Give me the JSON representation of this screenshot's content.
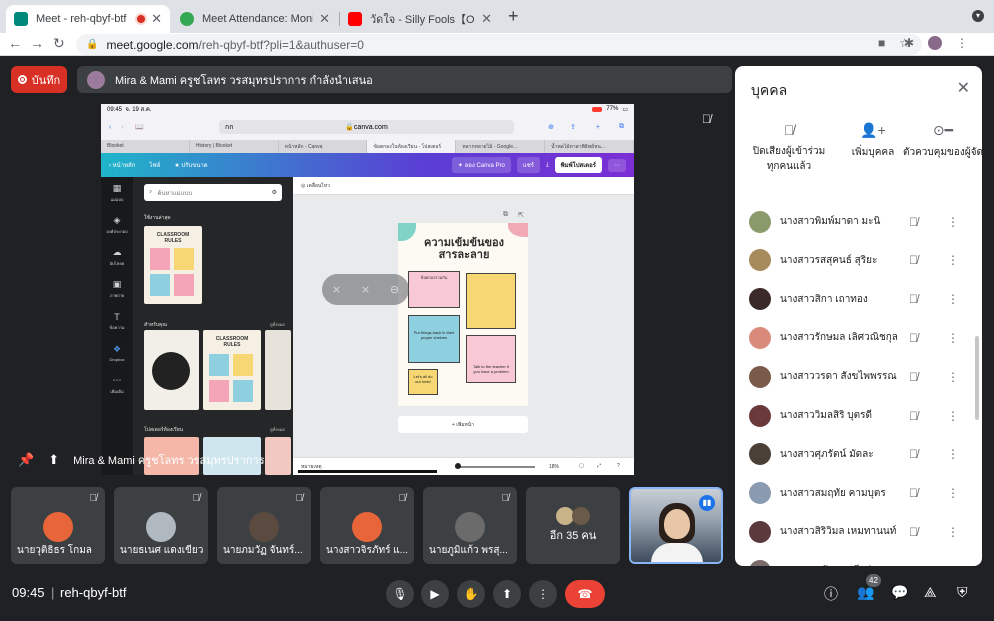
{
  "browser": {
    "tabs": [
      {
        "title": "Meet - reh-qbyf-btf",
        "active": true,
        "recording": true
      },
      {
        "title": "Meet Attendance: Monitor",
        "active": false
      },
      {
        "title": "วัดใจ - Silly Fools【OFFICIAL M",
        "active": false
      }
    ],
    "url_host": "meet.google.com",
    "url_path": "/reh-qbyf-btf?pli=1&authuser=0"
  },
  "meet": {
    "record_label": "บันทึก",
    "presenter_text": "Mira & Mami ครูชโลทร วรสมุทรปราการ กำลังนำเสนอ",
    "stage_caption": "Mira & Mami ครูชโลทร วรสมุทรปราการ",
    "meeting_time": "09:45",
    "meeting_code": "reh-qbyf-btf",
    "people_count": "42"
  },
  "shared_screen": {
    "status_time": "09:45",
    "status_date": "จ. 19 ส.ค.",
    "battery": "77%",
    "url": "canva.com",
    "address_aa": "กก",
    "safari_tabs": [
      "Blooket",
      "History | Blooket",
      "หน้าหลัก - Canva",
      "ข้อตกลงในห้องเรียน - โปสเตอร์",
      "หลากหลายไม้ - Google...",
      "น้ำพลไม้ทาสาพิธิพย์หน..."
    ],
    "canva_nav": [
      "หน้าหลัก",
      "ไฟล์",
      "ปรับขนาด"
    ],
    "canva_pro": "ลอง Canva Pro",
    "share": "แชร์",
    "print": "พิมพ์โปสเตอร์",
    "rail": [
      "แม่แบบ",
      "องค์ประกอบ",
      "อัปโหลด",
      "ภาพถ่าย",
      "ข้อความ",
      "Dropbox",
      "เพิ่มเติม"
    ],
    "search_placeholder": "ค้นหาแม่แบบ",
    "section_recent": "ใช้งานล่าสุด",
    "section_for_you": "สำหรับคุณ",
    "section_poster": "โปสเตอร์ห้องเรียน",
    "see_all": "ดูทั้งหมด",
    "thumb_text": "CLASSROOM RULES",
    "animate": "เคลื่อนไหว",
    "poster_title": "ความเข้มข้นของสารละลาย",
    "poster_sub": "ข้อตกลงร่วมกัน",
    "box_a": "Put things back in their proper shelves",
    "box_b": "Let's all do our best!",
    "box_c": "Talk to the teacher if you have a problem",
    "add_page": "+ เพิ่มหน้า",
    "notes": "หมายเหตุ",
    "zoom": "18%"
  },
  "tiles": [
    {
      "name": "นายวุติธิธร โกมล",
      "color": "#e8653a"
    },
    {
      "name": "นายธเนศ แดงเขียว",
      "color": "#b0b8c0"
    },
    {
      "name": "นายภมวัฏ จันทร์...",
      "color": "#5b4a3f"
    },
    {
      "name": "นางสาวจิรภัทร์ แ...",
      "color": "#e8653a"
    },
    {
      "name": "นายภูมิแก้ว พรสุ...",
      "color": "#6b6b6b"
    }
  ],
  "more_tile": "อีก 35 คน",
  "people_panel": {
    "title": "บุคคล",
    "actions": [
      "ปิดเสียงผู้เข้าร่วมทุกคนแล้ว",
      "เพิ่มบุคคล",
      "ตัวควบคุมของผู้จัด"
    ],
    "participants": [
      {
        "name": "นางสาวพิมพ์มาดา มะนิ",
        "color": "#8a9a6a"
      },
      {
        "name": "นางสาวรสสุคนธ์ สุริยะ",
        "color": "#a88b5c"
      },
      {
        "name": "นางสาวสิกา เถาทอง",
        "color": "#3a2a2a"
      },
      {
        "name": "นางสาวรักษมล เลิศวณิชกุล",
        "color": "#d98a7a"
      },
      {
        "name": "นางสาววรดา สังขไพพรรณ",
        "color": "#7a5a4a"
      },
      {
        "name": "นางสาววิมลสิริ บุตรดี",
        "color": "#6a3a3a"
      },
      {
        "name": "นางสาวศุภรัตน์ มัดละ",
        "color": "#4a4038"
      },
      {
        "name": "นางสาวสมฤทัย คามบุตร",
        "color": "#8a9ab0"
      },
      {
        "name": "นางสาวสิริวิมล เหมทานนท์",
        "color": "#5a3a3a"
      },
      {
        "name": "นางสาวสุพัตรา ศรีสว่าง",
        "color": "#7a6a6a"
      }
    ]
  }
}
